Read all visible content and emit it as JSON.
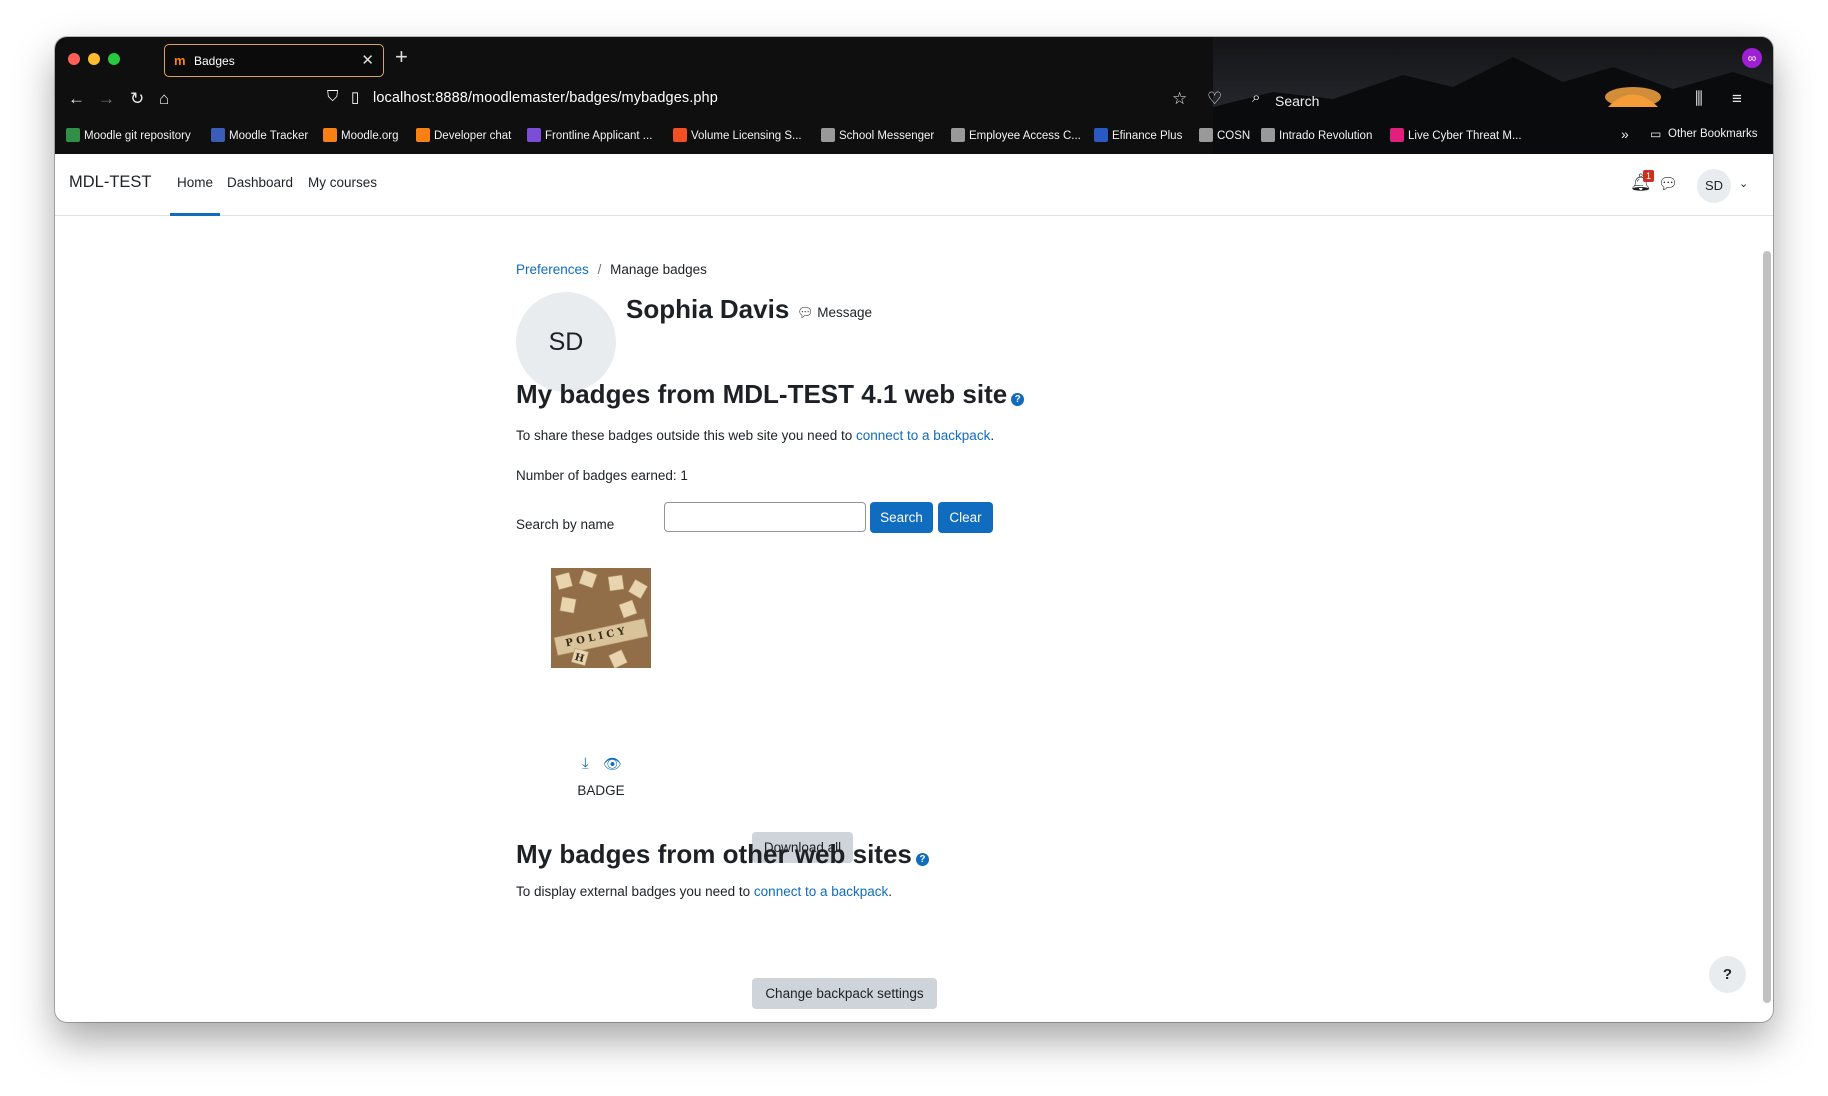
{
  "browser": {
    "tab_title": "Badges",
    "tab_favicon": "m",
    "url": "localhost:8888/moodlemaster/badges/mybadges.php",
    "search_label": "Search",
    "new_tab": "+",
    "close": "✕",
    "bookmarks": [
      {
        "label": "Moodle git repository",
        "icon": "git-icon",
        "color": "#2f8f46"
      },
      {
        "label": "Moodle Tracker",
        "icon": "moodle-tracker-icon",
        "color": "#3a5db8"
      },
      {
        "label": "Moodle.org",
        "icon": "moodle-icon",
        "color": "#f98012"
      },
      {
        "label": "Developer chat",
        "icon": "moodle-icon",
        "color": "#f98012"
      },
      {
        "label": "Frontline Applicant ...",
        "icon": "frontline-icon",
        "color": "#7a4fd6"
      },
      {
        "label": "Volume Licensing S...",
        "icon": "microsoft-icon",
        "color": "#f25022"
      },
      {
        "label": "School Messenger",
        "icon": "globe-icon",
        "color": "#999999"
      },
      {
        "label": "Employee Access C...",
        "icon": "globe-icon",
        "color": "#999999"
      },
      {
        "label": "Efinance Plus",
        "icon": "efinance-icon",
        "color": "#2b59c3"
      },
      {
        "label": "COSN",
        "icon": "globe-icon",
        "color": "#999999"
      },
      {
        "label": "Intrado Revolution",
        "icon": "globe-icon",
        "color": "#999999"
      },
      {
        "label": "Live Cyber Threat M...",
        "icon": "threat-map-icon",
        "color": "#e0207a"
      }
    ],
    "other_bookmarks": "Other Bookmarks"
  },
  "navbar": {
    "brand": "MDL-TEST",
    "links": [
      "Home",
      "Dashboard",
      "My courses"
    ],
    "notification_count": "1",
    "user_initials": "SD"
  },
  "breadcrumb": {
    "parent": "Preferences",
    "separator": "/",
    "current": "Manage badges"
  },
  "profile": {
    "initials": "SD",
    "name": "Sophia Davis",
    "message_label": "Message"
  },
  "section1": {
    "heading": "My badges from MDL-TEST 4.1 web site",
    "share_text": "To share these badges outside this web site you need to ",
    "share_link": "connect to a backpack",
    "share_end": ".",
    "count_text": "Number of badges earned: 1",
    "search_label": "Search by name",
    "search_value": "",
    "search_button": "Search",
    "clear_button": "Clear",
    "badge_name": "BADGE",
    "download_all": "Download all"
  },
  "section2": {
    "heading": "My badges from other web sites",
    "text": "To display external badges you need to ",
    "link": "connect to a backpack",
    "end": ".",
    "button": "Change backpack settings"
  },
  "help_button": "?",
  "help_icon": "?"
}
